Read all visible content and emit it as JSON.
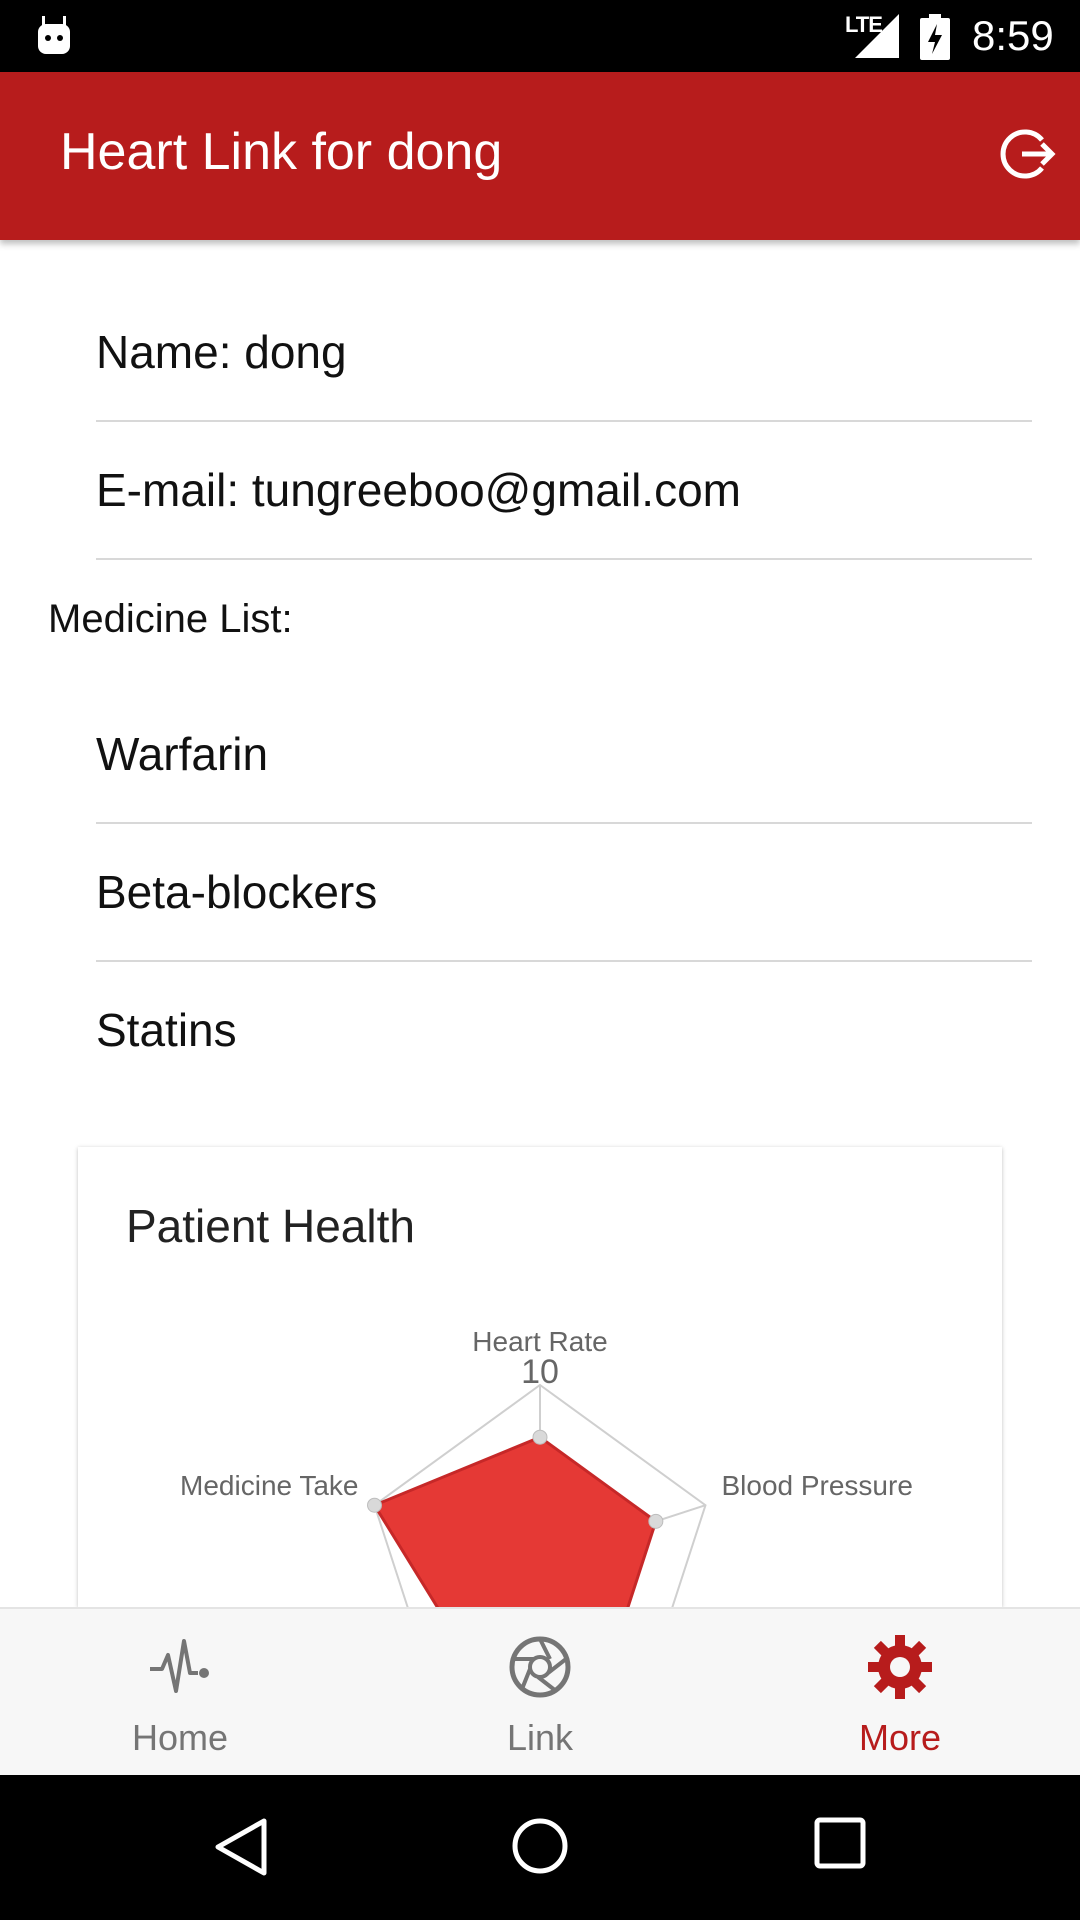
{
  "status_bar": {
    "network": "LTE",
    "time": "8:59"
  },
  "app_bar": {
    "title": "Heart Link for dong",
    "action_icon": "logout-icon"
  },
  "profile": {
    "name": "Name: dong",
    "email": "E-mail: tungreeboo@gmail.com"
  },
  "medicine": {
    "label": "Medicine List:",
    "items": [
      "Warfarin",
      "Beta-blockers",
      "Statins"
    ]
  },
  "card": {
    "title": "Patient Health"
  },
  "chart_data": {
    "type": "radar",
    "axes": [
      "Heart Rate",
      "Blood Pressure",
      "",
      "",
      "Medicine Take"
    ],
    "max": 10,
    "tick_label": "10",
    "series": [
      {
        "values": [
          7,
          7,
          7,
          7,
          10
        ],
        "color": "#e53935"
      }
    ]
  },
  "bottom_nav": {
    "items": [
      {
        "label": "Home",
        "icon": "pulse-icon",
        "active": false
      },
      {
        "label": "Link",
        "icon": "aperture-icon",
        "active": false
      },
      {
        "label": "More",
        "icon": "gear-icon",
        "active": true
      }
    ],
    "active_color": "#b71c1c",
    "inactive_color": "#757575"
  },
  "system_nav": {
    "buttons": [
      "back-icon",
      "home-icon",
      "recents-icon"
    ]
  }
}
